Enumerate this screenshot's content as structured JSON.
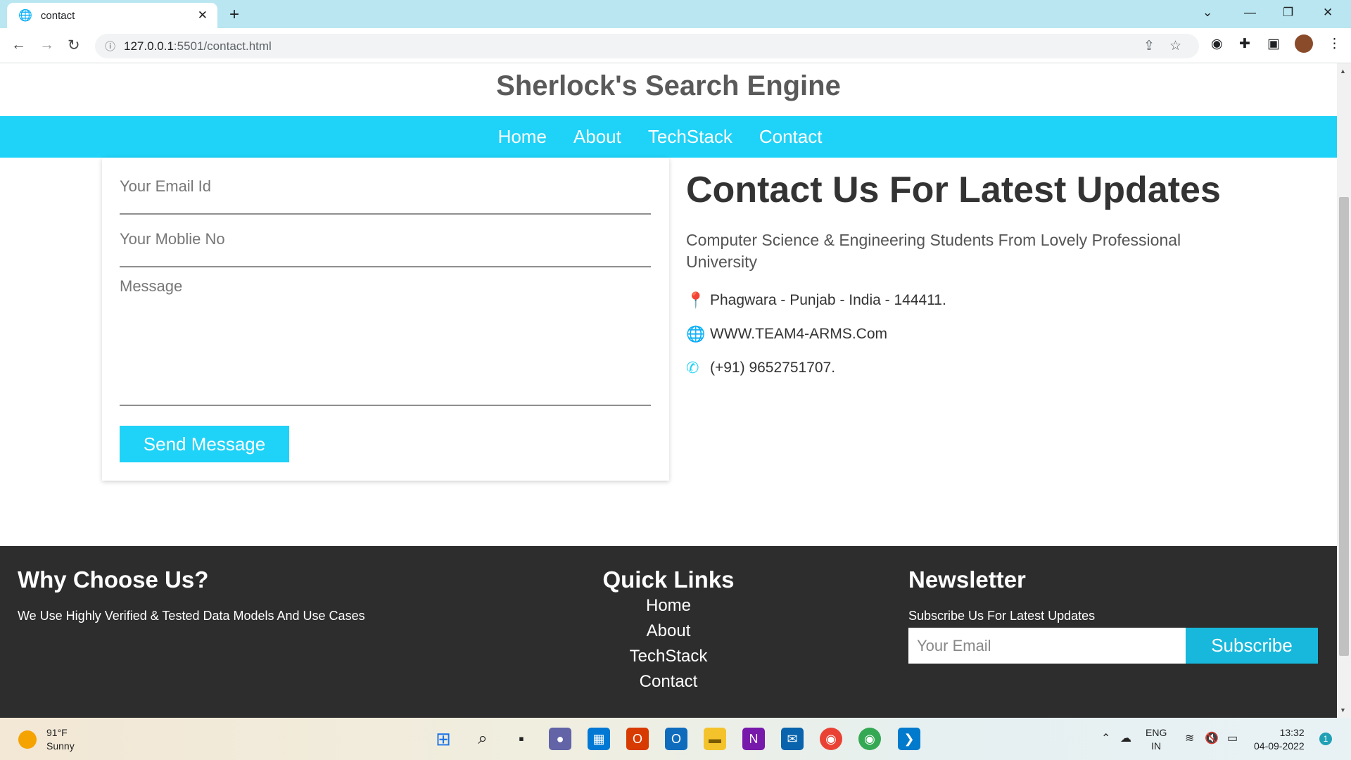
{
  "browser": {
    "tab_title": "contact",
    "new_tab": "+",
    "url_host": "127.0.0.1",
    "url_rest": ":5501/contact.html"
  },
  "site": {
    "brand": "Sherlock's Search Engine",
    "nav": [
      "Home",
      "About",
      "TechStack",
      "Contact"
    ]
  },
  "form": {
    "email_placeholder": "Your Email Id",
    "mobile_placeholder": "Your Moblie No",
    "message_placeholder": "Message",
    "send_label": "Send Message"
  },
  "info": {
    "heading": "Contact Us For Latest Updates",
    "subtitle": "Computer Science & Engineering Students From Lovely Professional University",
    "address": "Phagwara - Punjab - India - 144411.",
    "website": "WWW.TEAM4-ARMS.Com",
    "phone": "(+91) 9652751707."
  },
  "footer": {
    "why_title": "Why Choose Us?",
    "why_text": "We Use Highly Verified & Tested Data Models And Use Cases",
    "links_title": "Quick Links",
    "links": [
      "Home",
      "About",
      "TechStack",
      "Contact"
    ],
    "news_title": "Newsletter",
    "news_text": "Subscribe Us For Latest Updates",
    "email_placeholder": "Your Email",
    "subscribe_label": "Subscribe"
  },
  "taskbar": {
    "temp": "91°F",
    "condition": "Sunny",
    "lang1": "ENG",
    "lang2": "IN",
    "time": "13:32",
    "date": "04-09-2022",
    "notif": "1"
  },
  "colors": {
    "accent": "#1fd2f7",
    "footer_bg": "#2d2d2d"
  }
}
